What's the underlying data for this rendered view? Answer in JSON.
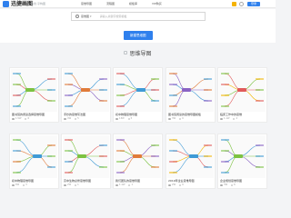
{
  "header": {
    "logo_text": "迅捷画图",
    "logo_sub": "在线·乎构图",
    "nav": [
      "思维导图",
      "流程图",
      "模板库",
      "VIP购买"
    ],
    "login_label": "登录"
  },
  "hero": {
    "search_type": "思维图",
    "search_placeholder": "请输入关键字搜索模板",
    "cta_label": "新建思维图"
  },
  "section": {
    "title": "思维导图"
  },
  "cards": [
    {
      "title": "图书馆的阅读选择思维导图",
      "views": "1.5W",
      "likes": "6"
    },
    {
      "title": "手抄的思维写法图",
      "views": "4W",
      "likes": "5"
    },
    {
      "title": "初中物理思维导图",
      "views": "13W",
      "likes": "5"
    },
    {
      "title": "图书馆阅读的思维导图模板",
      "views": "3W",
      "likes": "9"
    },
    {
      "title": "临床工作中的思维",
      "views": "1.1W",
      "likes": "2"
    },
    {
      "title": "初中物理思维导图",
      "views": "6W",
      "likes": "3"
    },
    {
      "title": "高中生物必修思维导图",
      "views": "2W",
      "likes": "1"
    },
    {
      "title": "我们团队的思维导图",
      "views": "1.1W",
      "likes": "1"
    },
    {
      "title": "2019年企业思维导图",
      "views": "2W",
      "likes": "9"
    },
    {
      "title": "企业规划思维导图",
      "views": "3W",
      "likes": "6"
    }
  ],
  "colors": {
    "accent": "#2f80ed",
    "vip": "#f5b301"
  }
}
